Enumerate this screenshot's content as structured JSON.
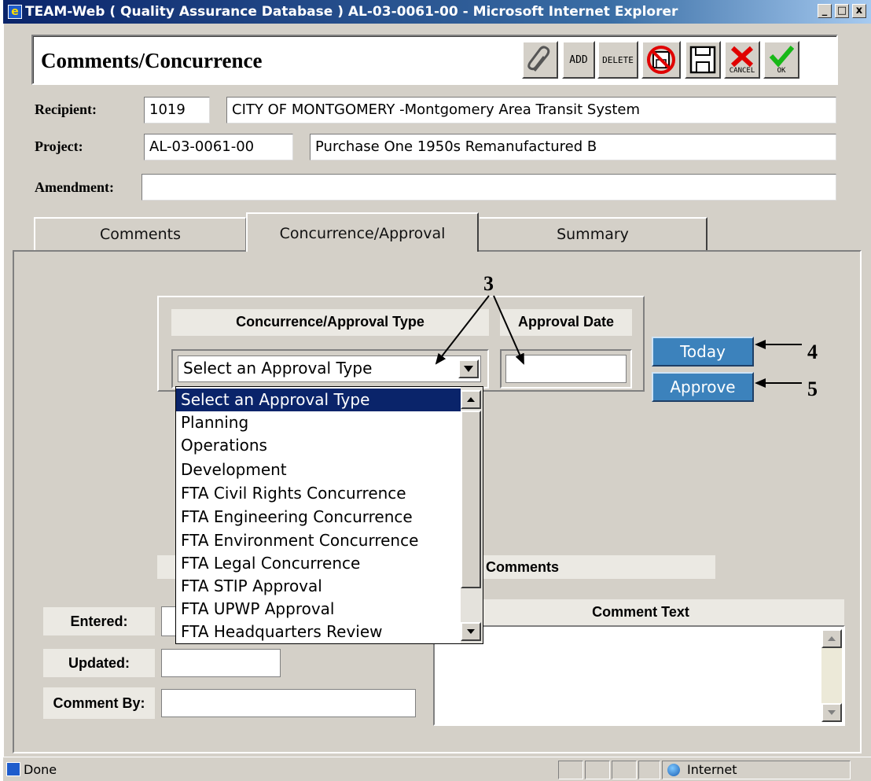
{
  "window": {
    "title": "TEAM-Web ( Quality Assurance Database ) AL-03-0061-00 - Microsoft Internet Explorer",
    "minimize": "_",
    "maximize": "□",
    "close": "x"
  },
  "header": {
    "title": "Comments/Concurrence",
    "toolbar": {
      "attach_icon": "paperclip-icon",
      "add_label": "ADD",
      "delete_label": "DELETE",
      "cancel_label": "CANCEL",
      "ok_label": "OK"
    }
  },
  "recipient": {
    "label": "Recipient:",
    "code": "1019",
    "name": "CITY OF MONTGOMERY -Montgomery Area Transit System"
  },
  "project": {
    "label": "Project:",
    "code": "AL-03-0061-00",
    "name": "Purchase One 1950s Remanufactured B"
  },
  "amendment": {
    "label": "Amendment:",
    "value": ""
  },
  "tabs": [
    {
      "label": "Comments"
    },
    {
      "label": "Concurrence/Approval"
    },
    {
      "label": "Summary"
    }
  ],
  "approval": {
    "type_header": "Concurrence/Approval Type",
    "date_header": "Approval Date",
    "select_value": "Select an Approval Type",
    "date_value": "",
    "today_button": "Today",
    "approve_button": "Approve",
    "options": [
      "Select an Approval Type",
      "Planning",
      "Operations",
      "Development",
      "FTA Civil Rights Concurrence",
      "FTA Engineering Concurrence",
      "FTA Environment Concurrence",
      "FTA Legal Concurrence",
      "FTA STIP Approval",
      "FTA UPWP Approval",
      "FTA Headquarters Review"
    ]
  },
  "annotations": {
    "a3": "3",
    "a4": "4",
    "a5": "5"
  },
  "comments": {
    "header": "Comments",
    "text_header": "Comment Text",
    "entered_label": "Entered:",
    "updated_label": "Updated:",
    "by_label": "Comment By:"
  },
  "status": {
    "text": "Done",
    "zone": "Internet"
  },
  "colors": {
    "button_blue": "#3c82bc",
    "selection": "#0a246a",
    "title_bar": "#0a246a"
  }
}
